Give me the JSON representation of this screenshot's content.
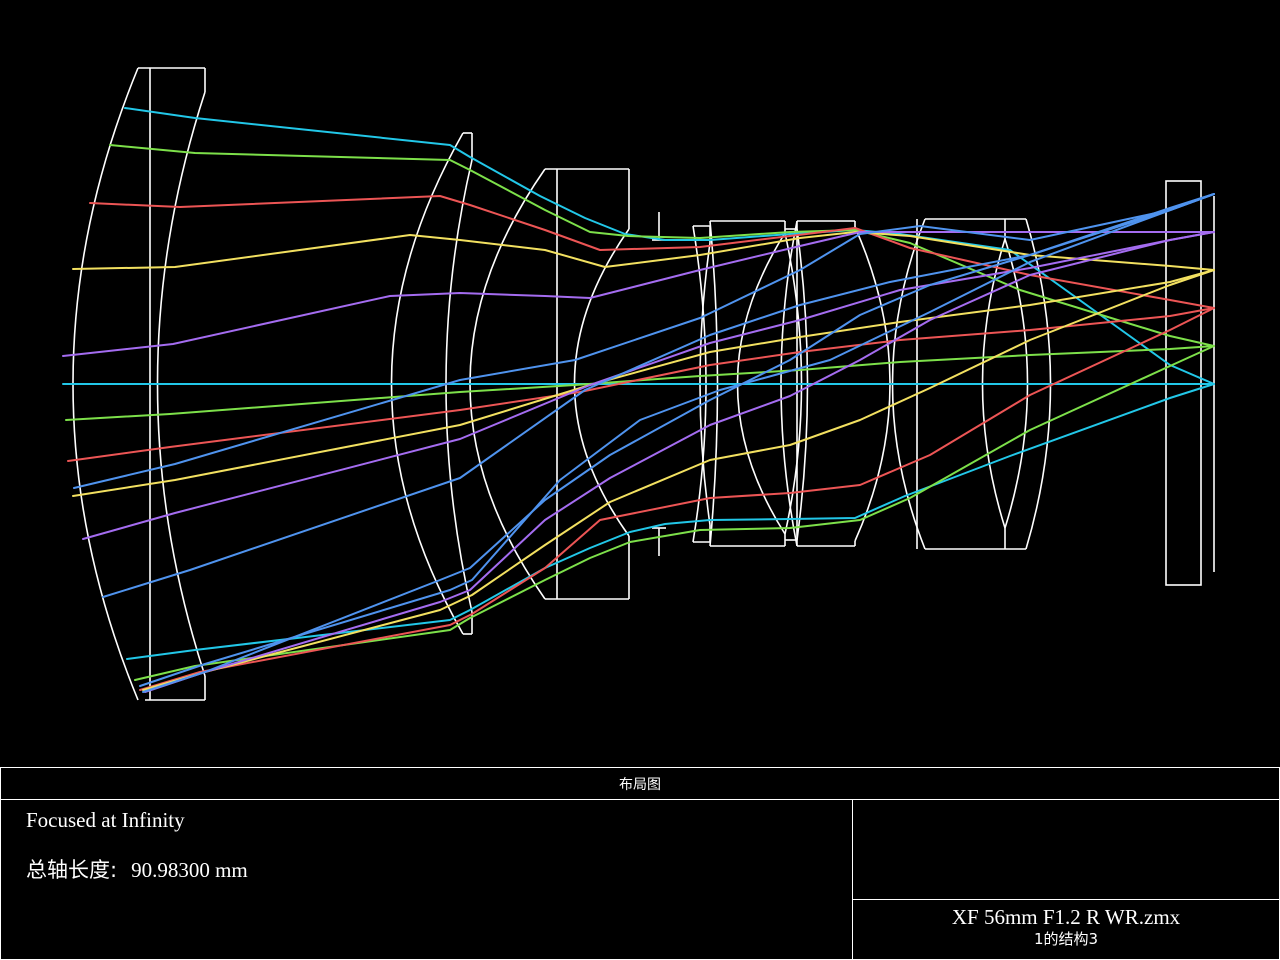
{
  "colors": {
    "background": "#000000",
    "lens_outline": "#ffffff",
    "rays": [
      "#22c7e8",
      "#7de04a",
      "#ec5555",
      "#f2e060",
      "#a46cf0",
      "#4f93ee"
    ]
  },
  "panel": {
    "title": "布局图",
    "line1": "Focused at Infinity",
    "axial_length_label": "总轴长度:",
    "axial_length_value": "90.98300 mm",
    "file_name": "XF 56mm F1.2 R WR.zmx",
    "configuration": "1的结构3"
  }
}
